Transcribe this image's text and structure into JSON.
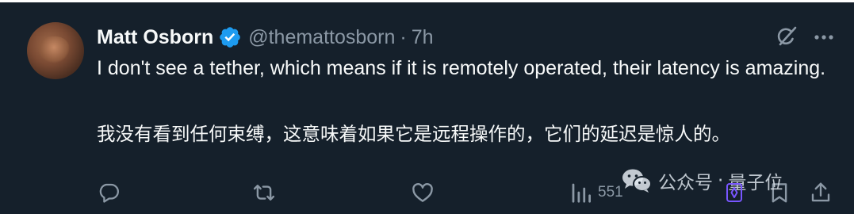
{
  "author": {
    "display_name": "Matt Osborn",
    "handle": "@themattosborn",
    "separator": "·",
    "time": "7h"
  },
  "tweet": {
    "text": "I don't see a tether, which means if it is remotely operated, their latency is amazing.",
    "text_zh": "我没有看到任何束缚，这意味着如果它是远程操作的，它们的延迟是惊人的。"
  },
  "actions": {
    "views_count": "551"
  },
  "watermark": {
    "source": "公众号",
    "separator": "·",
    "name": "量子位"
  },
  "icons": {
    "verified": "verified-badge-icon",
    "grok": "grok-icon",
    "more": "more-icon",
    "reply": "reply-icon",
    "retweet": "retweet-icon",
    "like": "like-icon",
    "views": "views-icon",
    "bookmark": "bookmark-icon",
    "share": "share-icon",
    "wechat": "wechat-icon"
  },
  "colors": {
    "background": "#15202b",
    "primary_text": "#f7f9f9",
    "secondary_text": "#8b98a5",
    "verified": "#1d9bf0"
  }
}
